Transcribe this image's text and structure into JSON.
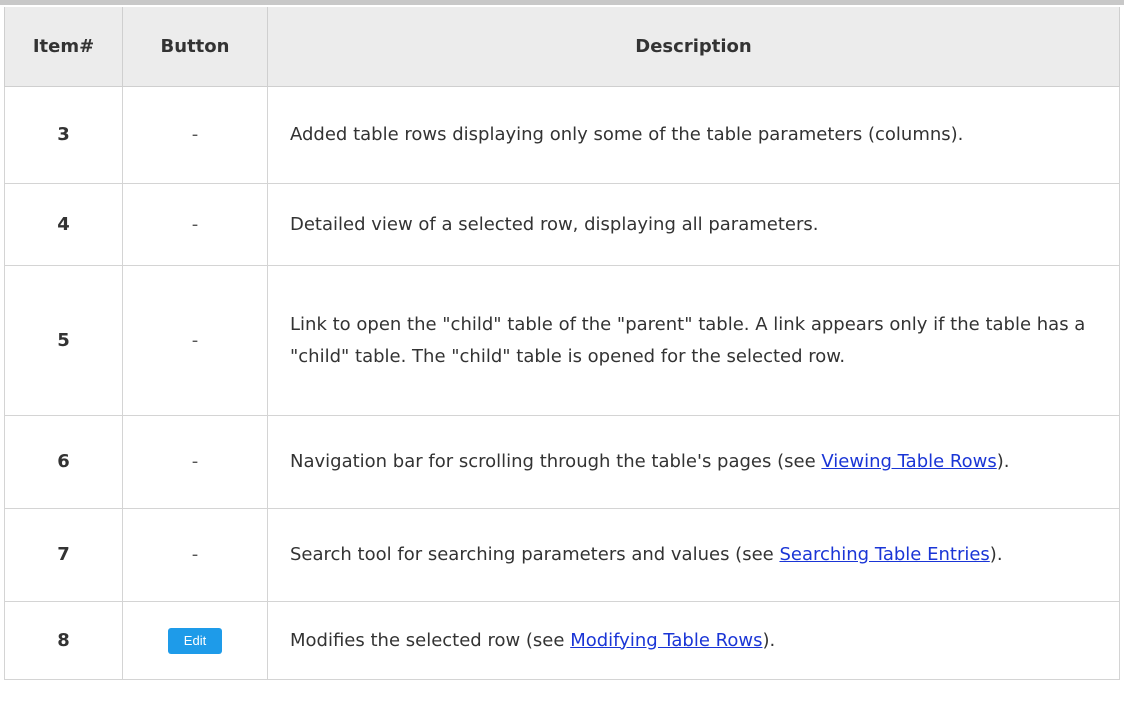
{
  "table": {
    "headers": {
      "item": "Item#",
      "button": "Button",
      "description": "Description"
    },
    "rows": [
      {
        "item": "3",
        "button": "-",
        "desc_text": "Added table rows displaying only some of the table parameters (columns)."
      },
      {
        "item": "4",
        "button": "-",
        "desc_text": "Detailed view of a selected row, displaying all parameters."
      },
      {
        "item": "5",
        "button": "-",
        "desc_text": "Link to open the \"child\" table of the \"parent\" table. A link appears only if the table has a \"child\" table. The \"child\" table is opened for the selected row."
      },
      {
        "item": "6",
        "button": "-",
        "desc_before": "Navigation bar for scrolling through the table's pages (see ",
        "link": "Viewing Table Rows",
        "desc_after": ")."
      },
      {
        "item": "7",
        "button": "-",
        "desc_before": "Search tool for searching parameters and values (see ",
        "link": "Searching Table Entries",
        "desc_after": ")."
      },
      {
        "item": "8",
        "button_label": "Edit",
        "desc_before": "Modifies the selected row (see ",
        "link": "Modifying Table Rows",
        "desc_after": ")."
      }
    ]
  },
  "colors": {
    "header_bg": "#ececec",
    "border": "#d4d4d4",
    "link": "#1a35d6",
    "edit_button": "#1e9be9"
  }
}
